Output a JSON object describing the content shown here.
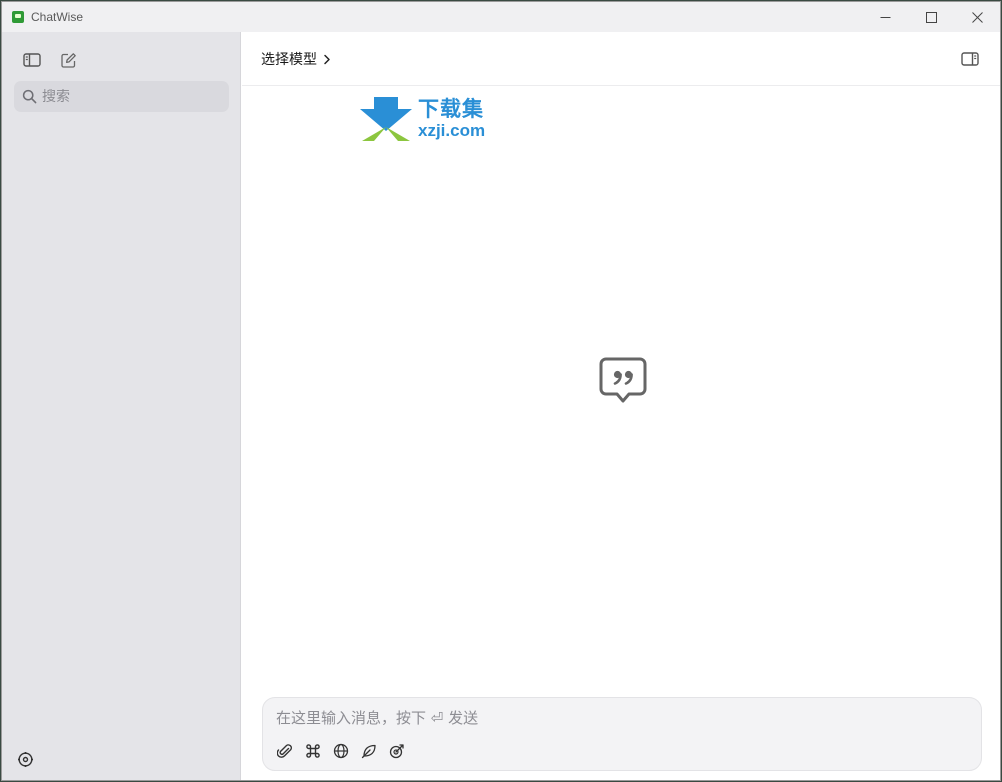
{
  "window": {
    "title": "ChatWise"
  },
  "sidebar": {
    "search_placeholder": "搜索",
    "icons": [
      "sidebar-toggle-icon",
      "new-chat-icon",
      "search-icon",
      "settings-icon"
    ]
  },
  "main": {
    "model_selector_label": "选择模型",
    "watermark": {
      "cn": "下载集",
      "url": "xzji.com"
    },
    "composer": {
      "placeholder": "在这里输入消息，按下 ⏎ 发送",
      "tools": [
        "attachment-icon",
        "command-icon",
        "web-search-icon",
        "leaf-icon",
        "tool-icon"
      ]
    }
  },
  "colors": {
    "sidebar_bg": "#e4e4e8",
    "titlebar_bg": "#f0f0f2",
    "composer_bg": "#f3f3f5",
    "watermark_blue": "#2a8fd6",
    "watermark_green": "#8cc63f"
  }
}
